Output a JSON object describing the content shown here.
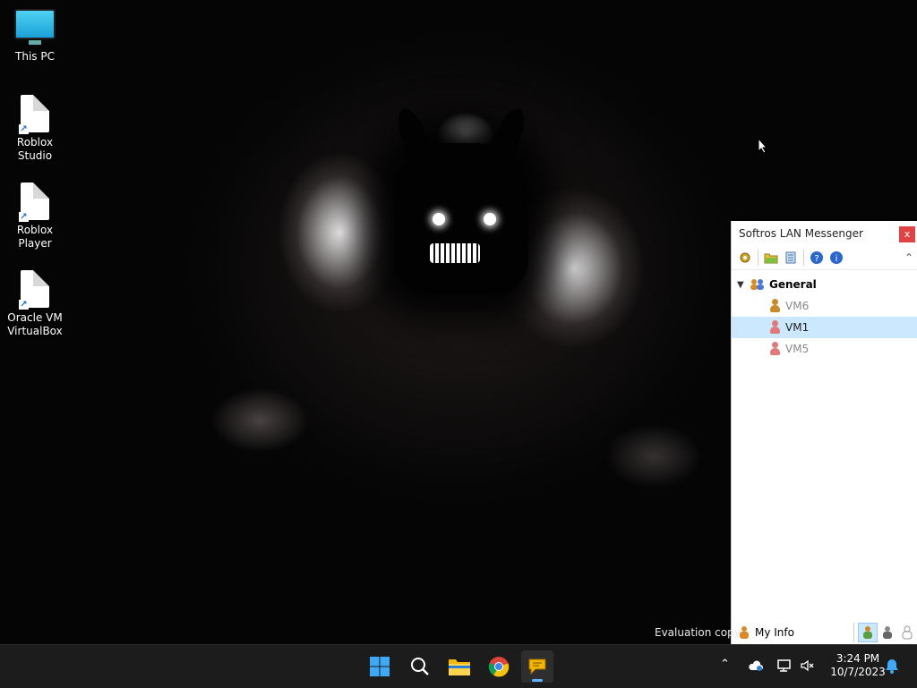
{
  "desktop": {
    "icons": [
      {
        "label": "This PC"
      },
      {
        "label": "Roblox Studio"
      },
      {
        "label": "Roblox Player"
      },
      {
        "label": "Oracle VM VirtualBox"
      }
    ],
    "watermark": "Evaluation copy"
  },
  "messenger": {
    "title": "Softros LAN Messenger",
    "close_label": "x",
    "group": {
      "name": "General"
    },
    "users": [
      {
        "name": "VM6",
        "status": "online",
        "color": "#c88a2a"
      },
      {
        "name": "VM1",
        "status": "offline",
        "color": "#e07a7a",
        "selected": true
      },
      {
        "name": "VM5",
        "status": "offline",
        "color": "#e07a7a"
      }
    ],
    "bottom": {
      "my_info_label": "My Info"
    },
    "colors": {
      "selected_row": "#cce8ff",
      "close_button": "#e04343"
    }
  },
  "taskbar": {
    "apps": [
      {
        "icon": "windows-start-icon"
      },
      {
        "icon": "search-icon"
      },
      {
        "icon": "file-explorer-icon"
      },
      {
        "icon": "chrome-icon"
      },
      {
        "icon": "softros-messenger-icon",
        "active": true
      }
    ],
    "clock": {
      "time": "3:24 PM",
      "date": "10/7/2023"
    }
  }
}
